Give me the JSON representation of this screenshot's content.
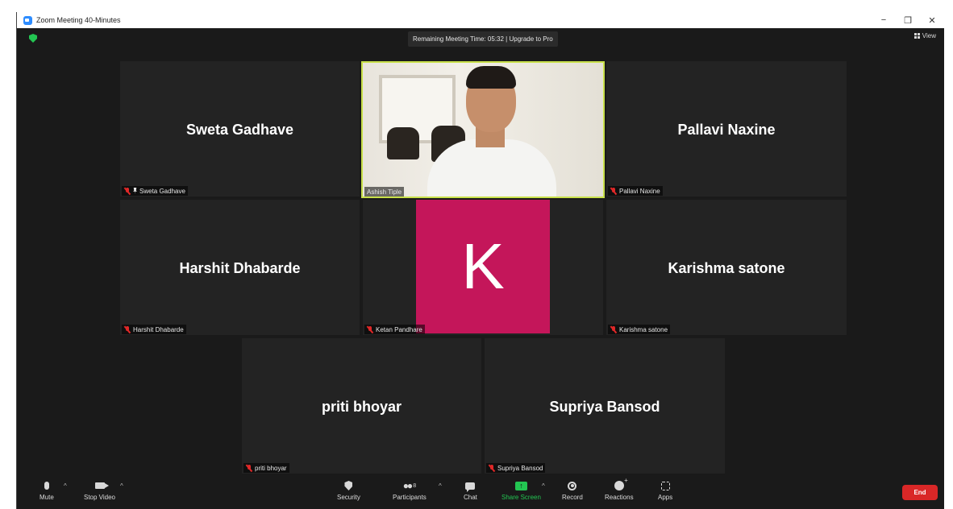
{
  "window": {
    "title": "Zoom Meeting 40-Minutes",
    "minimize": "−",
    "restore": "❐",
    "close": "✕"
  },
  "header": {
    "timer_text": "Remaining Meeting Time: 05:32 | Upgrade to Pro",
    "view_label": "View"
  },
  "participants": [
    {
      "display_name": "Sweta Gadhave",
      "label": "Sweta Gadhave",
      "muted": true,
      "pinned": true
    },
    {
      "display_name": "",
      "label": "Ashish Tiple",
      "muted": false,
      "video": true
    },
    {
      "display_name": "Pallavi Naxine",
      "label": "Pallavi Naxine",
      "muted": true
    },
    {
      "display_name": "Harshit Dhabarde",
      "label": "Harshit Dhabarde",
      "muted": true
    },
    {
      "display_name": "K",
      "label": "Ketan Pandhare",
      "muted": true,
      "avatar_color": "#c4165a"
    },
    {
      "display_name": "Karishma satone",
      "label": "Karishma satone",
      "muted": true
    },
    {
      "display_name": "priti bhoyar",
      "label": "priti bhoyar",
      "muted": true
    },
    {
      "display_name": "Supriya Bansod",
      "label": "Supriya Bansod",
      "muted": true
    }
  ],
  "toolbar": {
    "mute": "Mute",
    "stop_video": "Stop Video",
    "security": "Security",
    "participants": "Participants",
    "participants_count": "8",
    "chat": "Chat",
    "share_screen": "Share Screen",
    "record": "Record",
    "reactions": "Reactions",
    "apps": "Apps",
    "end": "End",
    "caret": "^",
    "share_arrow": "↑"
  },
  "colors": {
    "active_speaker_border": "#c8e04a",
    "share_green": "#23c552",
    "end_red": "#d92727",
    "muted_red": "#e02828"
  }
}
